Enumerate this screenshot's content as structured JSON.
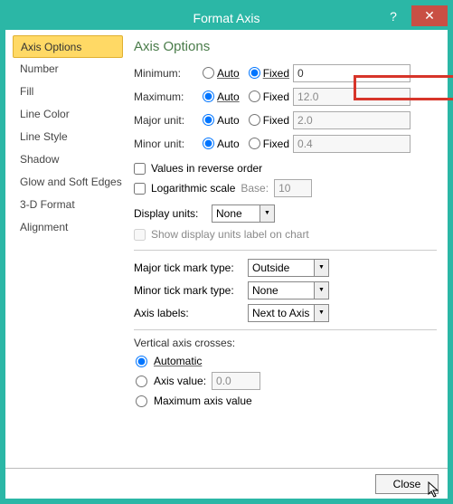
{
  "window": {
    "title": "Format Axis",
    "help": "?",
    "close": "✕"
  },
  "sidebar": {
    "items": [
      {
        "label": "Axis Options"
      },
      {
        "label": "Number"
      },
      {
        "label": "Fill"
      },
      {
        "label": "Line Color"
      },
      {
        "label": "Line Style"
      },
      {
        "label": "Shadow"
      },
      {
        "label": "Glow and Soft Edges"
      },
      {
        "label": "3-D Format"
      },
      {
        "label": "Alignment"
      }
    ],
    "active_index": 0
  },
  "axis_options": {
    "section_title": "Axis Options",
    "radio_labels": {
      "auto": "Auto",
      "fixed": "Fixed"
    },
    "minimum": {
      "label": "Minimum:",
      "mode": "fixed",
      "value": "0"
    },
    "maximum": {
      "label": "Maximum:",
      "mode": "auto",
      "value": "12.0"
    },
    "major_unit": {
      "label": "Major unit:",
      "mode": "auto",
      "value": "2.0"
    },
    "minor_unit": {
      "label": "Minor unit:",
      "mode": "auto",
      "value": "0.4"
    },
    "reverse_label": "Values in reverse order",
    "log_label": "Logarithmic scale",
    "log_base_label": "Base:",
    "log_base_value": "10",
    "display_units": {
      "label": "Display units:",
      "value": "None",
      "show_label_chk": "Show display units label on chart"
    },
    "major_tick": {
      "label": "Major tick mark type:",
      "value": "Outside"
    },
    "minor_tick": {
      "label": "Minor tick mark type:",
      "value": "None"
    },
    "axis_labels": {
      "label": "Axis labels:",
      "value": "Next to Axis"
    },
    "crosses": {
      "title": "Vertical axis crosses:",
      "auto_label": "Automatic",
      "axis_value_label": "Axis value:",
      "axis_value": "0.0",
      "max_label": "Maximum axis value",
      "selected": "auto"
    }
  },
  "buttons": {
    "close": "Close"
  }
}
